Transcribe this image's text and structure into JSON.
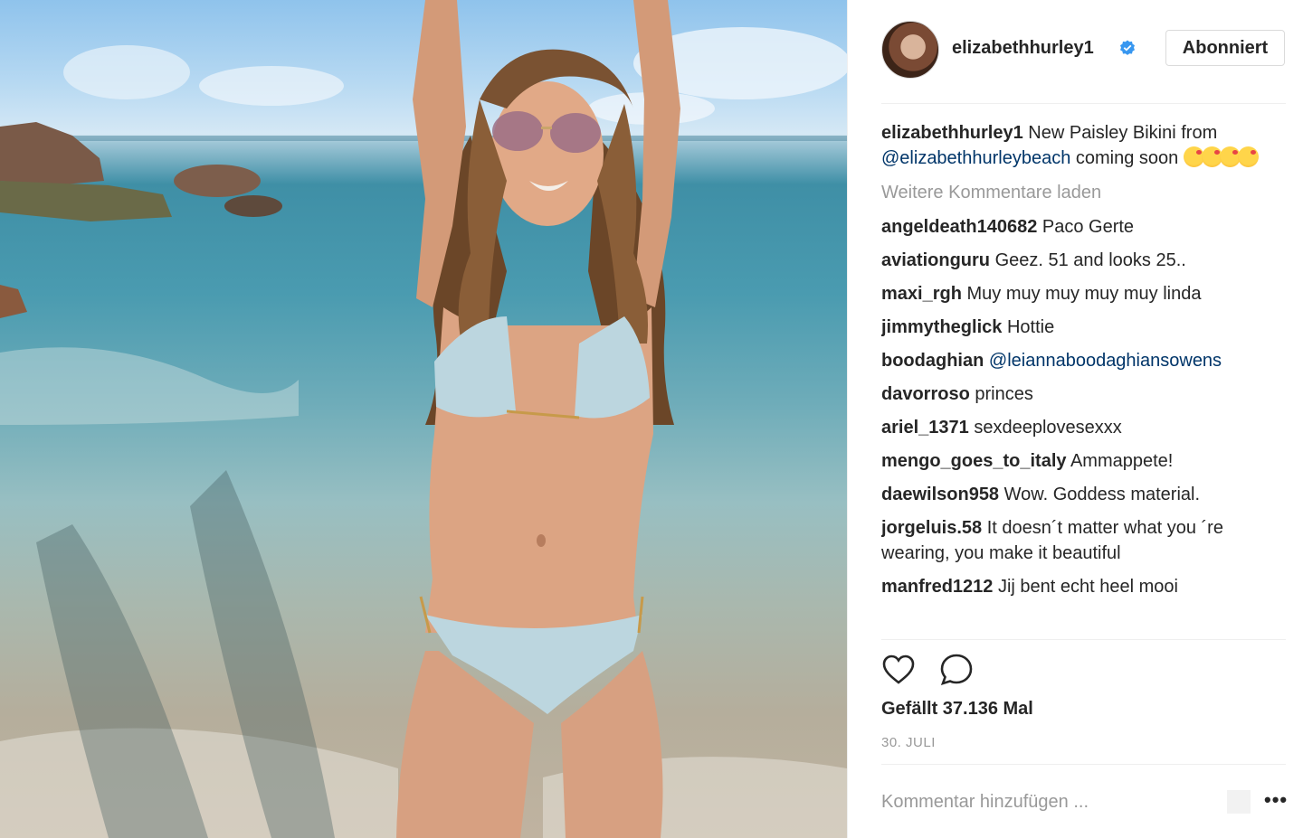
{
  "post": {
    "owner": "elizabethhurley1",
    "follow_label": "Abonniert",
    "caption": {
      "user": "elizabethhurley1",
      "text_before": "New Paisley Bikini from ",
      "mention": "@elizabethhurleybeach",
      "text_after": " coming soon"
    },
    "load_more": "Weitere Kommentare laden",
    "comments": [
      {
        "user": "angeldeath140682",
        "text": "Paco Gerte"
      },
      {
        "user": "aviationguru",
        "text": "Geez. 51 and looks 25.."
      },
      {
        "user": "maxi_rgh",
        "text": "Muy muy muy muy muy linda"
      },
      {
        "user": "jimmytheglick",
        "text": "Hottie"
      },
      {
        "user": "boodaghian",
        "text": "@leiannaboodaghiansowens"
      },
      {
        "user": "davorroso",
        "text": "princes"
      },
      {
        "user": "ariel_1371",
        "text": "sexdeeplovesexxx"
      },
      {
        "user": "mengo_goes_to_italy",
        "text": "Ammappete!"
      },
      {
        "user": "daewilson958",
        "text": "Wow. Goddess material."
      },
      {
        "user": "jorgeluis.58",
        "text": "It doesn´t matter what you ´re wearing, you make it beautiful"
      },
      {
        "user": "manfred1212",
        "text": "Jij bent echt heel mooi"
      }
    ],
    "likes": "Gefällt 37.136 Mal",
    "date": "30. JULI",
    "add_comment_placeholder": "Kommentar hinzufügen ...",
    "more_label": "•••",
    "icons": {
      "like": "heart-icon",
      "comment": "comment-bubble-icon",
      "verified": "verified-badge-icon"
    },
    "colors": {
      "verified": "#3897f0",
      "mention": "#003569",
      "muted": "#999999"
    }
  }
}
